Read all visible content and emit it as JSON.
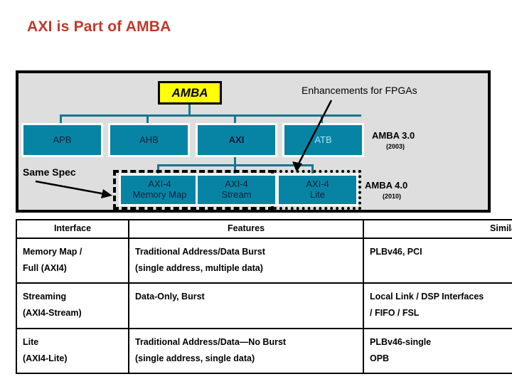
{
  "slide": {
    "title": "AXI is Part of AMBA"
  },
  "diagram": {
    "root": {
      "label": "AMBA"
    },
    "enhancements_note": "Enhancements for FPGAs",
    "same_spec_note": "Same Spec",
    "protocols_level1": [
      {
        "label": "APB",
        "style": "normal"
      },
      {
        "label": "AHB",
        "style": "normal"
      },
      {
        "label": "AXI",
        "style": "bold"
      },
      {
        "label": "ATB",
        "style": "light"
      }
    ],
    "protocols_level2": [
      {
        "line1": "AXI-4",
        "line2": "Memory Map"
      },
      {
        "line1": "AXI-4",
        "line2": "Stream"
      },
      {
        "line1": "AXI-4",
        "line2": "Lite"
      }
    ],
    "versions": [
      {
        "name": "AMBA 3.0",
        "year": "(2003)"
      },
      {
        "name": "AMBA 4.0",
        "year": "(2010)"
      }
    ],
    "colors": {
      "panel_bg": "#dedede",
      "box_fill": "#0784a4",
      "root_fill": "#ffff00",
      "connector": "#16778f",
      "title": "#c0392b"
    }
  },
  "table": {
    "headers": [
      "Interface",
      "Features",
      "Similar to"
    ],
    "rows": [
      {
        "interface": [
          "Memory Map /",
          "Full (AXI4)"
        ],
        "features": [
          "Traditional Address/Data Burst",
          "(single address, multiple data)"
        ],
        "similar": [
          "PLBv46, PCI"
        ]
      },
      {
        "interface": [
          "Streaming",
          "(AXI4-Stream)"
        ],
        "features": [
          "Data-Only, Burst"
        ],
        "similar": [
          "Local Link / DSP Interfaces",
          "/ FIFO / FSL"
        ]
      },
      {
        "interface": [
          "Lite",
          "(AXI4-Lite)"
        ],
        "features": [
          "Traditional Address/Data—No Burst",
          "(single address, single data)"
        ],
        "similar": [
          "PLBv46-single",
          "OPB"
        ]
      }
    ]
  }
}
